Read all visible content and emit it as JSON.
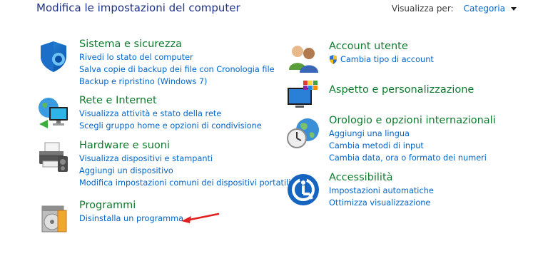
{
  "header": {
    "title": "Modifica le impostazioni del computer",
    "view_label": "Visualizza per:",
    "view_value": "Categoria"
  },
  "categories": {
    "system": {
      "title": "Sistema e sicurezza",
      "links": [
        "Rivedi lo stato del computer",
        "Salva copie di backup dei file con Cronologia file",
        "Backup e ripristino (Windows 7)"
      ]
    },
    "network": {
      "title": "Rete e Internet",
      "links": [
        "Visualizza attività e stato della rete",
        "Scegli gruppo home e opzioni di condivisione"
      ]
    },
    "hardware": {
      "title": "Hardware e suoni",
      "links": [
        "Visualizza dispositivi e stampanti",
        "Aggiungi un dispositivo",
        "Modifica impostazioni comuni dei dispositivi portatili"
      ]
    },
    "programs": {
      "title": "Programmi",
      "links": [
        "Disinstalla un programma"
      ]
    },
    "accounts": {
      "title": "Account utente",
      "links": [
        "Cambia tipo di account"
      ]
    },
    "appearance": {
      "title": "Aspetto e personalizzazione",
      "links": []
    },
    "clock": {
      "title": "Orologio e opzioni internazionali",
      "links": [
        "Aggiungi una lingua",
        "Cambia metodi di input",
        "Cambia data, ora o formato dei numeri"
      ]
    },
    "ease": {
      "title": "Accessibilità",
      "links": [
        "Impostazioni automatiche",
        "Ottimizza visualizzazione"
      ]
    }
  },
  "icons": {
    "system": "shield-icon",
    "network": "globe-network-icon",
    "hardware": "printer-icon",
    "programs": "programs-disc-icon",
    "accounts": "users-icon",
    "appearance": "monitor-palette-icon",
    "clock": "clock-globe-icon",
    "ease": "accessibility-icon",
    "uac": "uac-shield-icon",
    "annotation": "red-arrow-icon"
  },
  "colors": {
    "title_blue": "#1e3287",
    "category_green": "#0f7a2e",
    "link_blue": "#0066cc",
    "annotation_red": "#e0201f"
  }
}
